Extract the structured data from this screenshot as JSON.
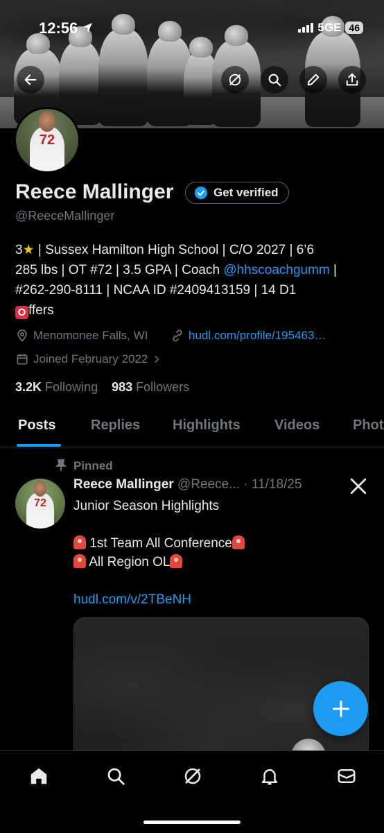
{
  "status_bar": {
    "time": "12:56",
    "network": "5GE",
    "battery": "46"
  },
  "profile": {
    "name": "Reece Mallinger",
    "handle": "@ReeceMallinger",
    "verify_label": "Get verified",
    "avatar_jersey": "72",
    "bio": {
      "line1_prefix": "3",
      "line1_text": " | Sussex Hamilton High School | C/O 2027 | 6’6",
      "line2_text": "285 lbs | OT #72 | 3.5 GPA | Coach ",
      "coach_link": "@hhscoachgumm",
      "line2_suffix": " |",
      "line3_text": "#262-290-8111 | NCAA ID #2409413159 | 14 D1",
      "offers_badge": "O",
      "offers_text": "ffers"
    },
    "location": "Menomonee Falls, WI",
    "website": "hudl.com/profile/195463…",
    "joined": "Joined February 2022",
    "following_count": "3.2K",
    "following_label": "Following",
    "followers_count": "983",
    "followers_label": "Followers"
  },
  "tabs": [
    {
      "label": "Posts",
      "active": true
    },
    {
      "label": "Replies"
    },
    {
      "label": "Highlights"
    },
    {
      "label": "Videos"
    },
    {
      "label": "Photos"
    }
  ],
  "tabs_visible": [
    "Posts",
    "Replies",
    "Highlights",
    "Videos",
    "Phot"
  ],
  "post": {
    "pinned_label": "Pinned",
    "author": "Reece Mallinger",
    "handle": "@Reece...",
    "separator": " · ",
    "date": "11/18/25",
    "avatar_jersey": "72",
    "line1": "Junior Season Highlights",
    "line2": " 1st Team All Conference",
    "line3": " All Region OL",
    "link": "hudl.com/v/2TBeNH"
  },
  "colors": {
    "accent": "#1d9bf0",
    "muted": "#71767b",
    "text": "#e7e9ea",
    "background": "#000000"
  },
  "icons": [
    "back-arrow-icon",
    "grok-icon",
    "search-icon",
    "edit-icon",
    "share-icon",
    "verified-badge-icon",
    "location-icon",
    "link-icon",
    "calendar-icon",
    "chevron-right-icon",
    "pin-icon",
    "x-logo-icon",
    "plus-icon",
    "home-icon",
    "explore-icon",
    "grok-nav-icon",
    "notifications-icon",
    "messages-icon"
  ]
}
